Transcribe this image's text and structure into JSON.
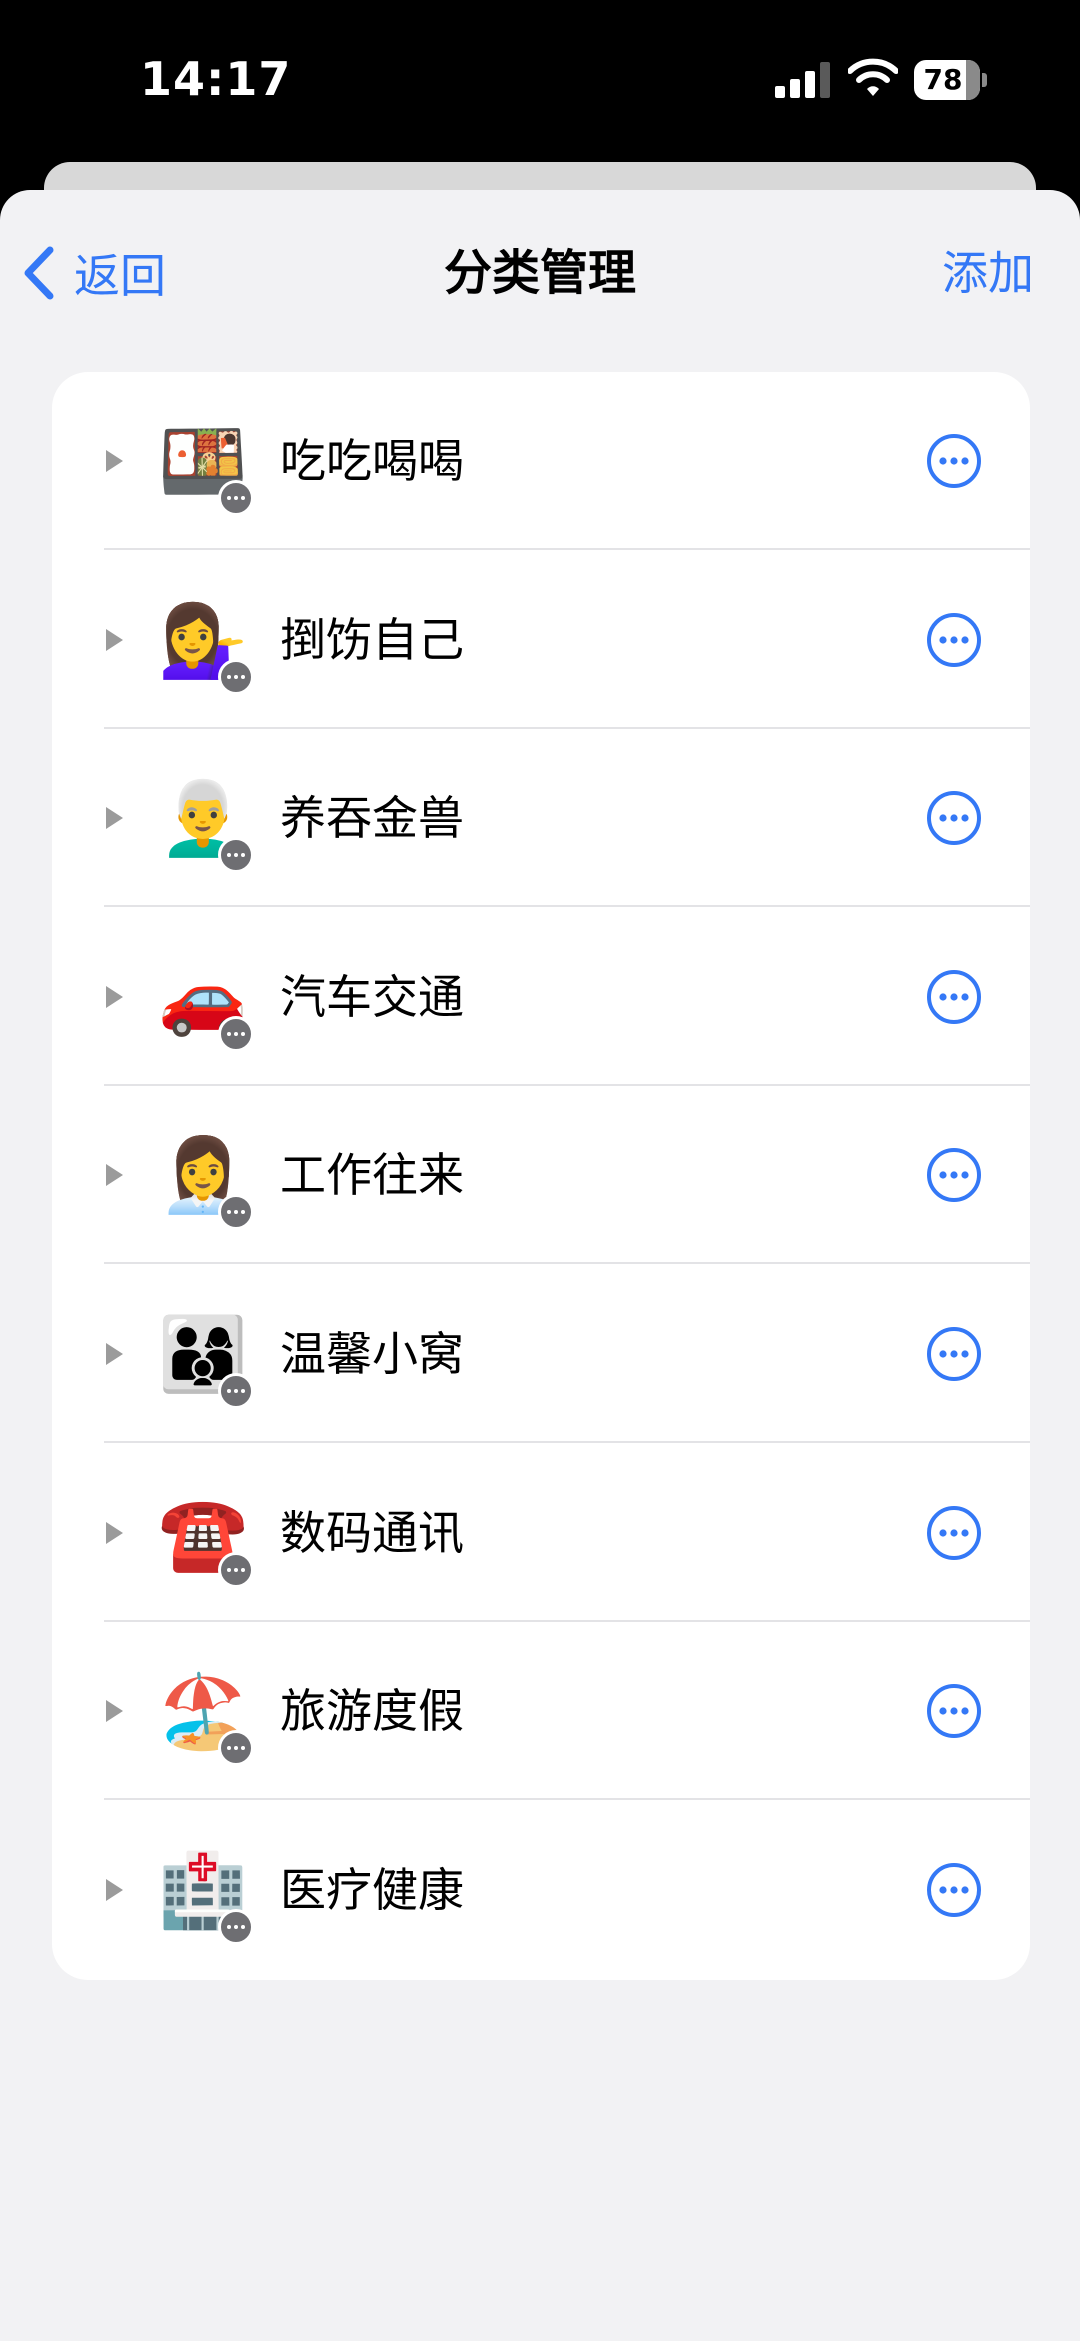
{
  "status_bar": {
    "time": "14:17",
    "battery": "78"
  },
  "nav": {
    "back_label": "返回",
    "title": "分类管理",
    "add_label": "添加"
  },
  "categories": [
    {
      "label": "吃吃喝喝",
      "icon": "🍱",
      "icon_name": "bento-box-icon"
    },
    {
      "label": "捯饬自己",
      "icon": "💁‍♀️",
      "icon_name": "girl-sticker-icon"
    },
    {
      "label": "养吞金兽",
      "icon": "👨‍🦳",
      "icon_name": "person-icon"
    },
    {
      "label": "汽车交通",
      "icon": "🚗",
      "icon_name": "car-icon"
    },
    {
      "label": "工作往来",
      "icon": "👩‍💼",
      "icon_name": "worker-sticker-icon"
    },
    {
      "label": "温馨小窝",
      "icon": "👨‍👩‍👦",
      "icon_name": "family-icon"
    },
    {
      "label": "数码通讯",
      "icon": "☎️",
      "icon_name": "telephone-icon"
    },
    {
      "label": "旅游度假",
      "icon": "🏖️",
      "icon_name": "beach-umbrella-icon"
    },
    {
      "label": "医疗健康",
      "icon": "🏥",
      "icon_name": "hospital-icon"
    }
  ],
  "colors": {
    "accent": "#3478f6",
    "background": "#f2f2f4",
    "card": "#ffffff",
    "badge": "#6e6e72"
  }
}
